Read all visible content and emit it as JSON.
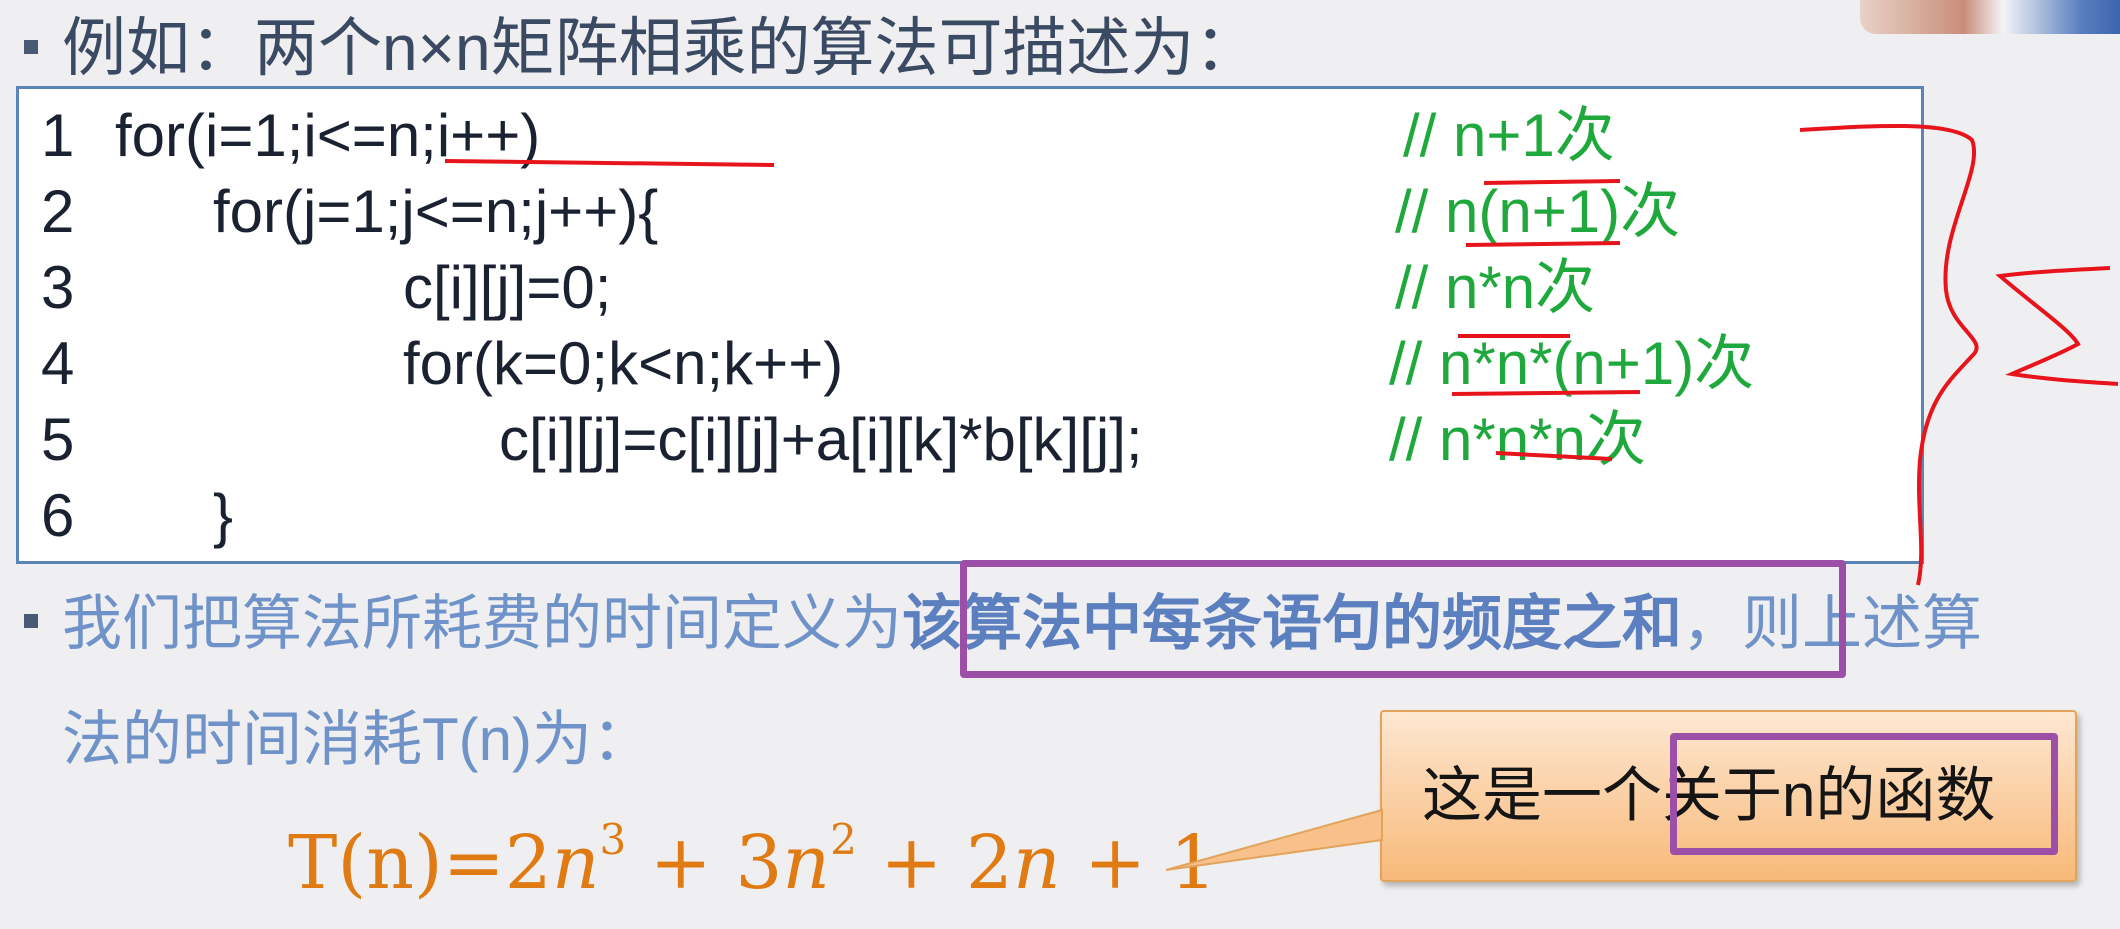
{
  "heading": "例如：两个n×n矩阵相乘的算法可描述为：",
  "code_lines": [
    {
      "num": "1",
      "code": "for(i=1;i<=n;i++)",
      "comment": "// n+1次"
    },
    {
      "num": "2",
      "code": "for(j=1;j<=n;j++){",
      "comment": "// n(n+1)次"
    },
    {
      "num": "3",
      "code": "c[i][j]=0;",
      "comment": "// n*n次"
    },
    {
      "num": "4",
      "code": "for(k=0;k<n;k++)",
      "comment": "// n*n*(n+1)次"
    },
    {
      "num": "5",
      "code": "c[i][j]=c[i][j]+a[i][k]*b[k][j];",
      "comment": "// n*n*n次"
    },
    {
      "num": "6",
      "code": "}",
      "comment": ""
    }
  ],
  "paragraph": {
    "before": "我们把算法所耗费的时间定义为",
    "highlight": "该算法中每条语句的频度之和",
    "after": "，则上述算",
    "line2": "法的时间消耗T(n)为："
  },
  "formula": {
    "lhs": "T(n)=",
    "c1": "2",
    "v1": "n",
    "e1": "3",
    "op1": " + ",
    "c2": "3",
    "v2": "n",
    "e2": "2",
    "op2": " + ",
    "c3": "2",
    "v3": "n",
    "op3": " + ",
    "c4": "1"
  },
  "callout": {
    "prefix": "这是一个",
    "emphasis": "关于n的函数"
  },
  "colors": {
    "code_border": "#5b84b8",
    "comment": "#1fa83c",
    "paragraph": "#6f93c8",
    "formula": "#e07a12",
    "annotation_red": "#e8141c",
    "annotation_purple": "#9b4fa6"
  }
}
